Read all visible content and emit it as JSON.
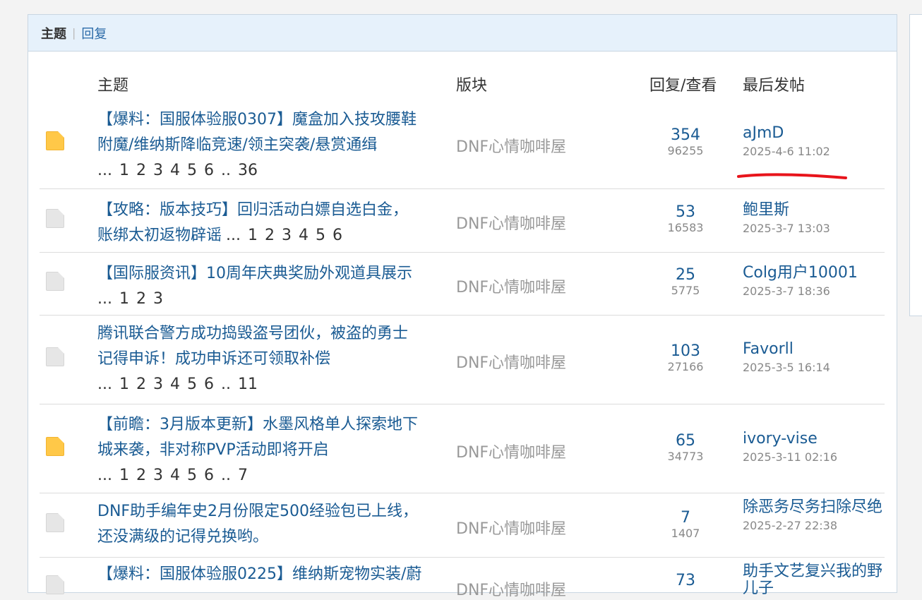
{
  "tabs": {
    "active": "主题",
    "other": "回复"
  },
  "columns": {
    "topic": "主题",
    "forum": "版块",
    "stats": "回复/查看",
    "last": "最后发帖"
  },
  "rows": [
    {
      "icon": "folder-hot-icon",
      "title_lines": [
        "【爆料：国服体验服0307】魔盒加入技攻腰鞋",
        "附魔/维纳斯降临竞速/领主突袭/悬赏通缉"
      ],
      "pages": [
        "...",
        "1",
        "2",
        "3",
        "4",
        "5",
        "6",
        "..",
        "36"
      ],
      "forum": "DNF心情咖啡屋",
      "replies": "354",
      "views": "96255",
      "last_user": "aJmD",
      "last_time": "2025-4-6 11:02"
    },
    {
      "icon": "folder-icon",
      "title_lines": [
        "【攻略：版本技巧】回归活动白嫖自选白金，",
        "账绑太初返物辟谣"
      ],
      "pages": [
        "...",
        "1",
        "2",
        "3",
        "4",
        "5",
        "6"
      ],
      "forum": "DNF心情咖啡屋",
      "replies": "53",
      "views": "16583",
      "last_user": "鲍里斯",
      "last_time": "2025-3-7 13:03"
    },
    {
      "icon": "folder-icon",
      "title_lines": [
        "【国际服资讯】10周年庆典奖励外观道具展示"
      ],
      "pages": [
        "...",
        "1",
        "2",
        "3"
      ],
      "forum": "DNF心情咖啡屋",
      "replies": "25",
      "views": "5775",
      "last_user": "Colg用户10001",
      "last_time": "2025-3-7 18:36"
    },
    {
      "icon": "folder-icon",
      "title_lines": [
        "腾讯联合警方成功捣毁盗号团伙，被盗的勇士",
        "记得申诉！成功申诉还可领取补偿"
      ],
      "pages": [
        "...",
        "1",
        "2",
        "3",
        "4",
        "5",
        "6",
        "..",
        "11"
      ],
      "forum": "DNF心情咖啡屋",
      "replies": "103",
      "views": "27166",
      "last_user": "Favorll",
      "last_time": "2025-3-5 16:14"
    },
    {
      "icon": "folder-hot-icon",
      "title_lines": [
        "【前瞻：3月版本更新】水墨风格单人探索地下",
        "城来袭，非对称PVP活动即将开启"
      ],
      "pages": [
        "...",
        "1",
        "2",
        "3",
        "4",
        "5",
        "6",
        "..",
        "7"
      ],
      "forum": "DNF心情咖啡屋",
      "replies": "65",
      "views": "34773",
      "last_user": "ivory-vise",
      "last_time": "2025-3-11 02:16"
    },
    {
      "icon": "folder-icon",
      "title_lines": [
        "DNF助手编年史2月份限定500经验包已上线，",
        "还没满级的记得兑换哟。"
      ],
      "pages": [],
      "forum": "DNF心情咖啡屋",
      "replies": "7",
      "views": "1407",
      "last_user": "除恶务尽务扫除尽绝",
      "last_time": "2025-2-27 22:38"
    },
    {
      "icon": "folder-icon",
      "title_lines": [
        "【爆料：国服体验服0225】维纳斯宠物实装/蔚"
      ],
      "pages": [],
      "forum": "DNF心情咖啡屋",
      "replies": "73",
      "views": "",
      "last_user": "助手文艺复兴我的野儿子",
      "last_time": ""
    }
  ],
  "annotation_color": "#e8141b"
}
